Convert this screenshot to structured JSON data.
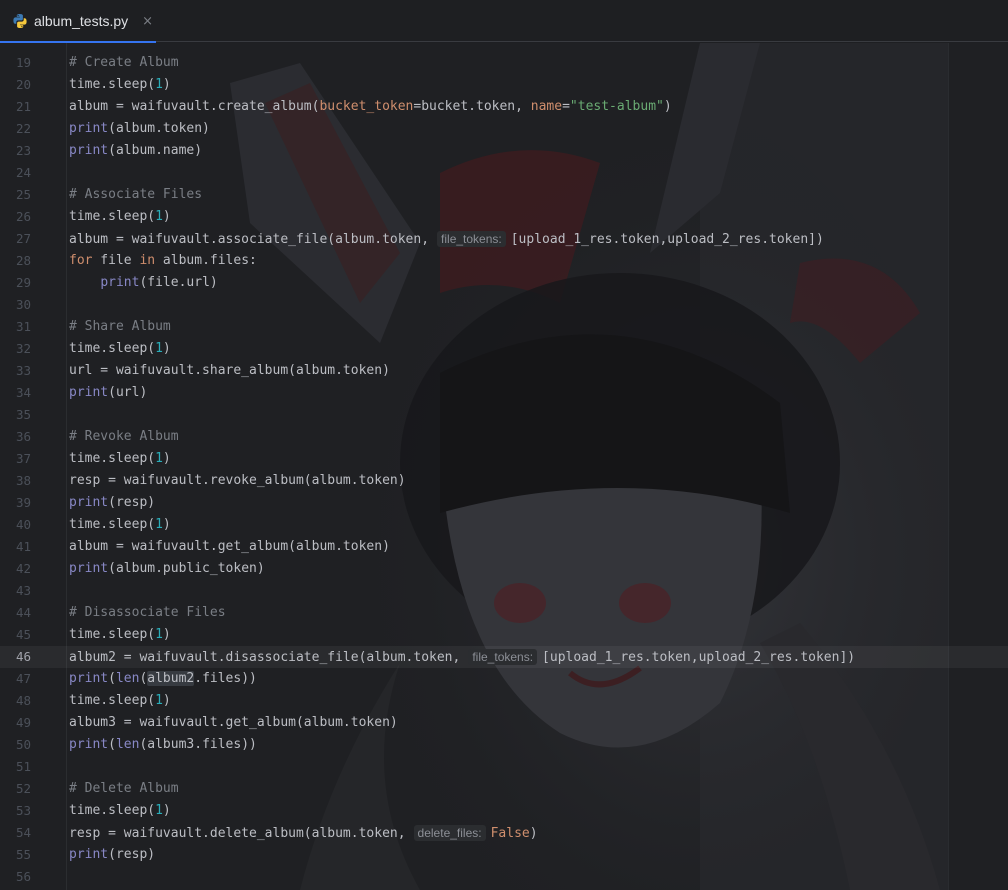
{
  "tab": {
    "filename": "album_tests.py",
    "close_glyph": "×",
    "icon": "python-file-icon"
  },
  "colors": {
    "background": "#1e1f22",
    "comment": "#7a7e85",
    "keyword": "#cf8e6d",
    "builtin": "#8888c6",
    "number": "#2aacb8",
    "string": "#6aab73",
    "text": "#bcbec4",
    "accent": "#3574f0"
  },
  "editor": {
    "current_line": 46,
    "lines": [
      {
        "num": "19",
        "tokens": [
          {
            "t": "# Create Album",
            "c": "cm"
          }
        ]
      },
      {
        "num": "20",
        "tokens": [
          {
            "t": "time.sleep(",
            "c": "txt"
          },
          {
            "t": "1",
            "c": "num"
          },
          {
            "t": ")",
            "c": "txt"
          }
        ]
      },
      {
        "num": "21",
        "tokens": [
          {
            "t": "album = waifuvault.create_album(",
            "c": "txt"
          },
          {
            "t": "bucket_token",
            "c": "prm"
          },
          {
            "t": "=bucket.token, ",
            "c": "txt"
          },
          {
            "t": "name",
            "c": "prm"
          },
          {
            "t": "=",
            "c": "txt"
          },
          {
            "t": "\"test-album\"",
            "c": "str"
          },
          {
            "t": ")",
            "c": "txt"
          }
        ]
      },
      {
        "num": "22",
        "tokens": [
          {
            "t": "print",
            "c": "bi"
          },
          {
            "t": "(album.token)",
            "c": "txt"
          }
        ]
      },
      {
        "num": "23",
        "tokens": [
          {
            "t": "print",
            "c": "bi"
          },
          {
            "t": "(album.name)",
            "c": "txt"
          }
        ]
      },
      {
        "num": "24",
        "tokens": []
      },
      {
        "num": "25",
        "tokens": [
          {
            "t": "# Associate Files",
            "c": "cm"
          }
        ]
      },
      {
        "num": "26",
        "tokens": [
          {
            "t": "time.sleep(",
            "c": "txt"
          },
          {
            "t": "1",
            "c": "num"
          },
          {
            "t": ")",
            "c": "txt"
          }
        ]
      },
      {
        "num": "27",
        "tokens": [
          {
            "t": "album = waifuvault.associate_file(album.token,",
            "c": "txt"
          },
          {
            "t": "file_tokens:",
            "c": "hint"
          },
          {
            "t": "[upload_1_res.token,upload_2_res.token])",
            "c": "txt"
          }
        ]
      },
      {
        "num": "28",
        "tokens": [
          {
            "t": "for",
            "c": "kw"
          },
          {
            "t": " file ",
            "c": "txt"
          },
          {
            "t": "in",
            "c": "kw"
          },
          {
            "t": " album.files:",
            "c": "txt"
          }
        ]
      },
      {
        "num": "29",
        "tokens": [
          {
            "t": "    ",
            "c": "txt"
          },
          {
            "t": "print",
            "c": "bi"
          },
          {
            "t": "(file.url)",
            "c": "txt"
          }
        ]
      },
      {
        "num": "30",
        "tokens": []
      },
      {
        "num": "31",
        "tokens": [
          {
            "t": "# Share Album",
            "c": "cm"
          }
        ]
      },
      {
        "num": "32",
        "tokens": [
          {
            "t": "time.sleep(",
            "c": "txt"
          },
          {
            "t": "1",
            "c": "num"
          },
          {
            "t": ")",
            "c": "txt"
          }
        ]
      },
      {
        "num": "33",
        "tokens": [
          {
            "t": "url = waifuvault.share_album(album.token)",
            "c": "txt"
          }
        ]
      },
      {
        "num": "34",
        "tokens": [
          {
            "t": "print",
            "c": "bi"
          },
          {
            "t": "(url)",
            "c": "txt"
          }
        ]
      },
      {
        "num": "35",
        "tokens": []
      },
      {
        "num": "36",
        "tokens": [
          {
            "t": "# Revoke Album",
            "c": "cm"
          }
        ]
      },
      {
        "num": "37",
        "tokens": [
          {
            "t": "time.sleep(",
            "c": "txt"
          },
          {
            "t": "1",
            "c": "num"
          },
          {
            "t": ")",
            "c": "txt"
          }
        ]
      },
      {
        "num": "38",
        "tokens": [
          {
            "t": "resp = waifuvault.revoke_album(album.token)",
            "c": "txt"
          }
        ]
      },
      {
        "num": "39",
        "tokens": [
          {
            "t": "print",
            "c": "bi"
          },
          {
            "t": "(resp)",
            "c": "txt"
          }
        ]
      },
      {
        "num": "40",
        "tokens": [
          {
            "t": "time.sleep(",
            "c": "txt"
          },
          {
            "t": "1",
            "c": "num"
          },
          {
            "t": ")",
            "c": "txt"
          }
        ]
      },
      {
        "num": "41",
        "tokens": [
          {
            "t": "album = waifuvault.get_album(album.token)",
            "c": "txt"
          }
        ]
      },
      {
        "num": "42",
        "tokens": [
          {
            "t": "print",
            "c": "bi"
          },
          {
            "t": "(album.public_token)",
            "c": "txt"
          }
        ]
      },
      {
        "num": "43",
        "tokens": []
      },
      {
        "num": "44",
        "tokens": [
          {
            "t": "# Disassociate Files",
            "c": "cm"
          }
        ]
      },
      {
        "num": "45",
        "tokens": [
          {
            "t": "time.sleep(",
            "c": "txt"
          },
          {
            "t": "1",
            "c": "num"
          },
          {
            "t": ")",
            "c": "txt"
          }
        ]
      },
      {
        "num": "46",
        "tokens": [
          {
            "t": "album2 = waifuvault.disassociate_file(album.token,",
            "c": "txt"
          },
          {
            "t": "file_tokens:",
            "c": "hint"
          },
          {
            "t": "[upload_1_res.token,upload_2_res.token])",
            "c": "txt"
          }
        ]
      },
      {
        "num": "47",
        "tokens": [
          {
            "t": "print",
            "c": "bi"
          },
          {
            "t": "(",
            "c": "txt"
          },
          {
            "t": "len",
            "c": "bi"
          },
          {
            "t": "(",
            "c": "txt"
          },
          {
            "t": "album2",
            "c": "hl"
          },
          {
            "t": ".files))",
            "c": "txt"
          }
        ]
      },
      {
        "num": "48",
        "tokens": [
          {
            "t": "time.sleep(",
            "c": "txt"
          },
          {
            "t": "1",
            "c": "num"
          },
          {
            "t": ")",
            "c": "txt"
          }
        ]
      },
      {
        "num": "49",
        "tokens": [
          {
            "t": "album3 = waifuvault.get_album(album.token)",
            "c": "txt"
          }
        ]
      },
      {
        "num": "50",
        "tokens": [
          {
            "t": "print",
            "c": "bi"
          },
          {
            "t": "(",
            "c": "txt"
          },
          {
            "t": "len",
            "c": "bi"
          },
          {
            "t": "(album3.files))",
            "c": "txt"
          }
        ]
      },
      {
        "num": "51",
        "tokens": []
      },
      {
        "num": "52",
        "tokens": [
          {
            "t": "# Delete Album",
            "c": "cm"
          }
        ]
      },
      {
        "num": "53",
        "tokens": [
          {
            "t": "time.sleep(",
            "c": "txt"
          },
          {
            "t": "1",
            "c": "num"
          },
          {
            "t": ")",
            "c": "txt"
          }
        ]
      },
      {
        "num": "54",
        "tokens": [
          {
            "t": "resp = waifuvault.delete_album(album.token,",
            "c": "txt"
          },
          {
            "t": "delete_files:",
            "c": "hint"
          },
          {
            "t": "False",
            "c": "kw"
          },
          {
            "t": ")",
            "c": "txt"
          }
        ]
      },
      {
        "num": "55",
        "tokens": [
          {
            "t": "print",
            "c": "bi"
          },
          {
            "t": "(resp)",
            "c": "txt"
          }
        ]
      },
      {
        "num": "56",
        "tokens": []
      }
    ]
  }
}
